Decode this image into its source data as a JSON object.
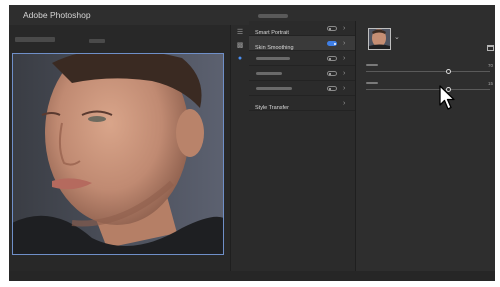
{
  "app": {
    "title": "Adobe Photoshop"
  },
  "toolstrip": {
    "icons": [
      "sliders-icon",
      "layers-icon",
      "dot-icon"
    ],
    "active_index": 2
  },
  "filters": [
    {
      "name": "smart-portrait",
      "label": "Smart Portrait",
      "enabled": false
    },
    {
      "name": "skin-smoothing",
      "label": "Skin Smoothing",
      "enabled": true,
      "selected": true
    },
    {
      "name": "filter-3",
      "label": "",
      "enabled": false
    },
    {
      "name": "filter-4",
      "label": "",
      "enabled": false
    },
    {
      "name": "filter-5",
      "label": "",
      "enabled": false
    },
    {
      "name": "style-transfer",
      "label": "Style Transfer",
      "enabled": false
    }
  ],
  "settings": {
    "sliders": [
      {
        "name": "blur-slider",
        "value_label": "70",
        "fraction": 0.65
      },
      {
        "name": "smoothness-slider",
        "value_label": "15",
        "fraction": 0.65
      }
    ]
  },
  "colors": {
    "accent": "#3f7fe6",
    "panel_bg": "#2b2b2b",
    "selection_outline": "#6f8fc8"
  }
}
